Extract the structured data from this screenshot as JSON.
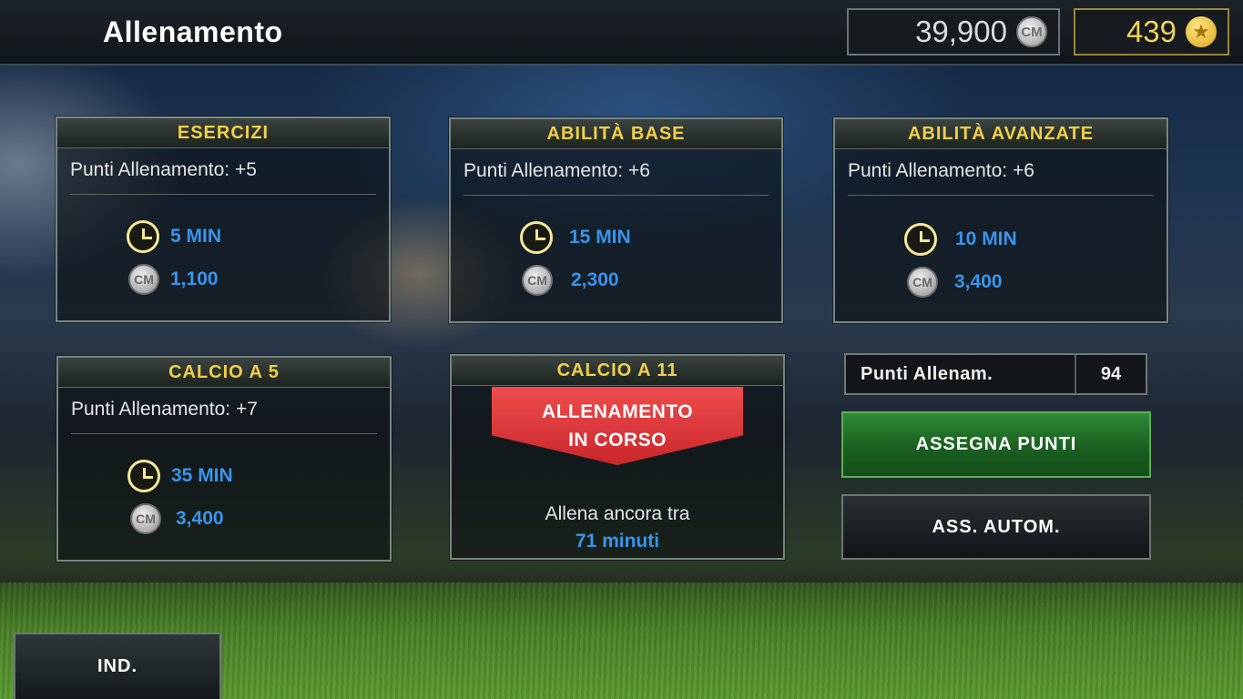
{
  "header": {
    "title": "Allenamento",
    "currency_cm": "39,900",
    "currency_cm_icon": "CM",
    "currency_gold": "439",
    "currency_gold_icon": "★"
  },
  "coin_label": "CM",
  "cards": [
    {
      "title": "ESERCIZI",
      "points": "Punti Allenamento: +5",
      "time": "5 MIN",
      "cost": "1,100"
    },
    {
      "title": "ABILITÀ BASE",
      "points": "Punti Allenamento: +6",
      "time": "15 MIN",
      "cost": "2,300"
    },
    {
      "title": "ABILITÀ AVANZATE",
      "points": "Punti Allenamento: +6",
      "time": "10 MIN",
      "cost": "3,400"
    },
    {
      "title": "CALCIO A 5",
      "points": "Punti Allenamento: +7",
      "time": "35 MIN",
      "cost": "3,400"
    }
  ],
  "active_card": {
    "title": "CALCIO A 11",
    "ribbon_line1": "ALLENAMENTO",
    "ribbon_line2": "IN CORSO",
    "retrain_text": "Allena ancora tra",
    "retrain_time": "71 minuti"
  },
  "training_points": {
    "label": "Punti Allenam.",
    "value": "94"
  },
  "buttons": {
    "assign": "ASSEGNA PUNTI",
    "auto_assign": "ASS. AUTOM.",
    "back": "IND."
  },
  "colors": {
    "accent_yellow": "#f2cf48",
    "value_blue": "#3a94ea",
    "ribbon_red": "#e2393d",
    "assign_green": "#1f6b25"
  }
}
